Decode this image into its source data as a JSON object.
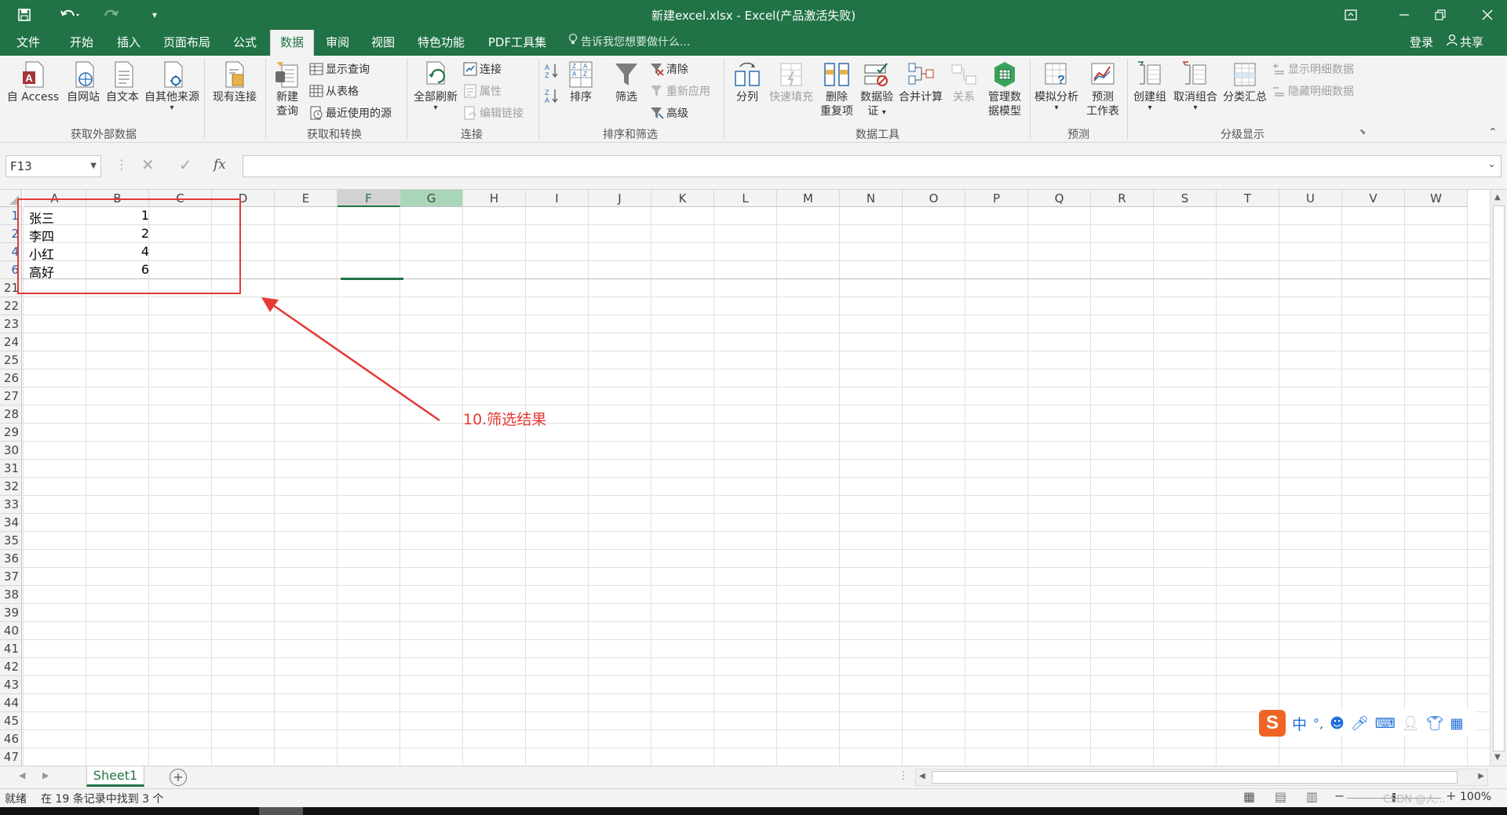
{
  "titlebar": {
    "title": "新建excel.xlsx - Excel(产品激活失败)",
    "save_icon": "save-icon",
    "undo_icon": "undo-icon",
    "redo_icon": "redo-icon"
  },
  "tabs": [
    "文件",
    "开始",
    "插入",
    "页面布局",
    "公式",
    "数据",
    "审阅",
    "视图",
    "特色功能",
    "PDF工具集"
  ],
  "active_tab": "数据",
  "tell_me": "告诉我您想要做什么...",
  "login": "登录",
  "share": "共享",
  "ribbon": {
    "external": {
      "group_label": "获取外部数据",
      "buttons": [
        "自 Access",
        "自网站",
        "自文本",
        "自其他来源"
      ]
    },
    "existing": "现有连接",
    "transform": {
      "group_label": "获取和转换",
      "new_query_line1": "新建",
      "new_query_line2": "查询",
      "small": [
        "显示查询",
        "从表格",
        "最近使用的源"
      ]
    },
    "connections": {
      "group_label": "连接",
      "refresh_all": "全部刷新",
      "small": [
        "连接",
        "属性",
        "编辑链接"
      ]
    },
    "sortfilter": {
      "group_label": "排序和筛选",
      "sort": "排序",
      "filter": "筛选",
      "small": [
        "清除",
        "重新应用",
        "高级"
      ]
    },
    "datatools": {
      "group_label": "数据工具",
      "split": "分列",
      "flash_fill": "快速填充",
      "remove_dup_line1": "删除",
      "remove_dup_line2": "重复项",
      "validation_line1": "数据验",
      "validation_line2": "证",
      "consolidate": "合并计算",
      "relations": "关系",
      "model_line1": "管理数",
      "model_line2": "据模型"
    },
    "forecast": {
      "group_label": "预测",
      "whatif": "模拟分析",
      "sheet_line1": "预测",
      "sheet_line2": "工作表"
    },
    "outline": {
      "group_label": "分级显示",
      "group": "创建组",
      "ungroup": "取消组合",
      "subtotal": "分类汇总",
      "small": [
        "显示明细数据",
        "隐藏明细数据"
      ]
    }
  },
  "formula_bar": {
    "name_box": "F13",
    "fx": "fx",
    "value": ""
  },
  "columns": [
    "A",
    "B",
    "C",
    "D",
    "E",
    "F",
    "G",
    "H",
    "I",
    "J",
    "K",
    "L",
    "M",
    "N",
    "O",
    "P",
    "Q",
    "R",
    "S",
    "T",
    "U",
    "V",
    "W"
  ],
  "selected_column": "F",
  "rows": [
    "1",
    "2",
    "4",
    "6",
    "21",
    "22",
    "23",
    "24",
    "25",
    "26",
    "27",
    "28",
    "29",
    "30",
    "31",
    "32",
    "33",
    "34",
    "35",
    "36",
    "37",
    "38",
    "39",
    "40",
    "41",
    "42",
    "43",
    "44",
    "45",
    "46",
    "47"
  ],
  "filtered_rows": [
    "1",
    "2",
    "4",
    "6"
  ],
  "table_rows": [
    {
      "name": "张三",
      "value": "1"
    },
    {
      "name": "李四",
      "value": "2"
    },
    {
      "name": "小红",
      "value": "4"
    },
    {
      "name": "高好",
      "value": "6"
    }
  ],
  "annotation": "10.筛选结果",
  "annotation_color": "#e53935",
  "accent_color": "#217346",
  "ime_bar": [
    "中",
    "°,"
  ],
  "sheet_tab": "Sheet1",
  "status": {
    "ready": "就绪",
    "message": "在 19 条记录中找到 3 个",
    "zoom": "100%",
    "watermark": "CSDN @人..."
  }
}
